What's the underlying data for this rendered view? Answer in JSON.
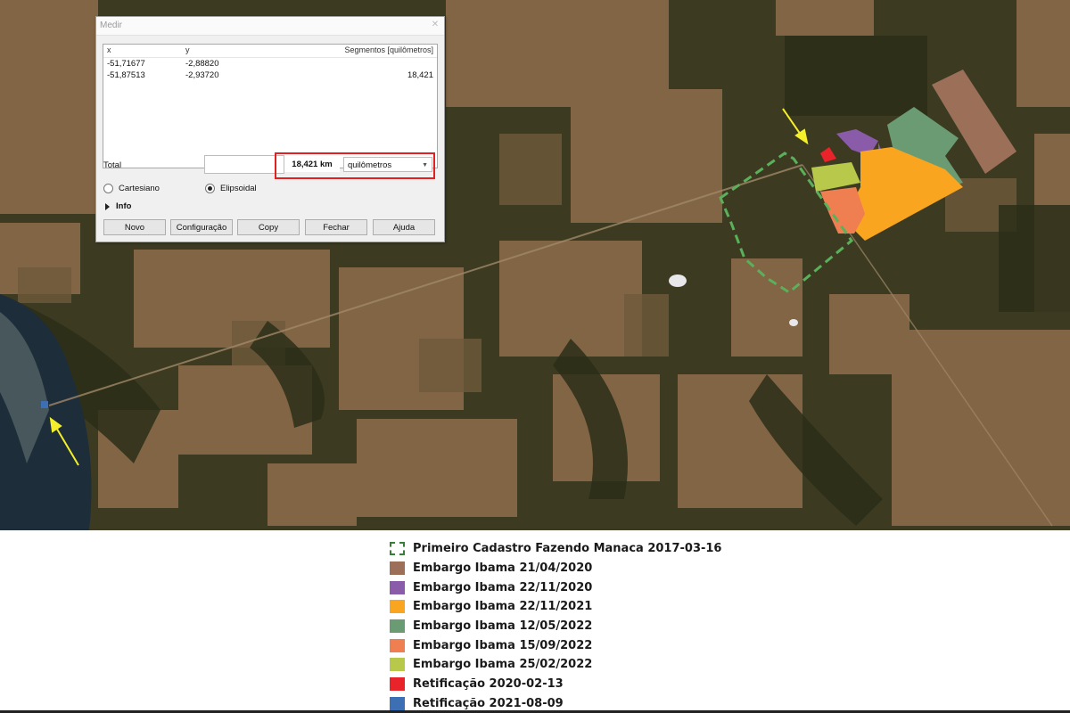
{
  "dialog": {
    "title": "Medir",
    "columns": {
      "x": "x",
      "y": "y",
      "segments": "Segmentos [quilômetros]"
    },
    "rows": [
      {
        "x": "-51,71677",
        "y": "-2,88820",
        "segment": ""
      },
      {
        "x": "-51,87513",
        "y": "-2,93720",
        "segment": "18,421"
      }
    ],
    "total_label": "Total",
    "total_value": "18,421 km",
    "unit_selected": "quilômetros",
    "radio_cartesian": "Cartesiano",
    "radio_ellipsoidal": "Elipsoidal",
    "info_label": "Info",
    "buttons": {
      "new": "Novo",
      "config": "Configuração",
      "copy": "Copy",
      "close": "Fechar",
      "help": "Ajuda"
    },
    "highlight_color": "#e22020"
  },
  "legend": [
    {
      "label": "Primeiro Cadastro Fazendo Manaca 2017-03-16",
      "color": "#3a7d3a",
      "style": "dashed-outline"
    },
    {
      "label": "Embargo Ibama 21/04/2020",
      "color": "#9c7058"
    },
    {
      "label": "Embargo Ibama 22/11/2020",
      "color": "#8a5ba8"
    },
    {
      "label": "Embargo Ibama 22/11/2021",
      "color": "#f9a520"
    },
    {
      "label": "Embargo Ibama 12/05/2022",
      "color": "#6b9b73"
    },
    {
      "label": "Embargo Ibama 15/09/2022",
      "color": "#ef7e50"
    },
    {
      "label": "Embargo Ibama 25/02/2022",
      "color": "#b8c84a"
    },
    {
      "label": "Retificação 2020-02-13",
      "color": "#e8242a"
    },
    {
      "label": "Retificação 2021-08-09",
      "color": "#3d6fb5"
    }
  ],
  "map": {
    "arrow_color": "#f4ef2a"
  }
}
